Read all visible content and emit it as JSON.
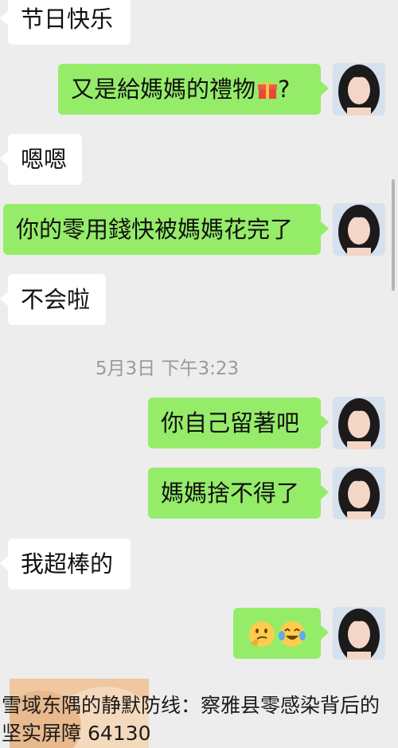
{
  "messages": [
    {
      "side": "in",
      "text": "节日快乐"
    },
    {
      "side": "out",
      "text": "又是給媽媽的禮物",
      "emoji": "gift",
      "suffix": "?"
    },
    {
      "side": "in",
      "text": "嗯嗯"
    },
    {
      "side": "out",
      "text": "你的零用錢快被媽媽花完了"
    },
    {
      "side": "in",
      "text": "不会啦"
    },
    {
      "side": "out",
      "text": "你自己留著吧"
    },
    {
      "side": "out",
      "text": "媽媽捨不得了"
    },
    {
      "side": "in",
      "text": "我超棒的"
    },
    {
      "side": "out",
      "emojis": [
        "thinking-face",
        "crying-laughing-face"
      ]
    }
  ],
  "timestamp": "5月3日 下午3:23",
  "overlay_caption": "雪域东隅的静默防线：察雅县零感染背后的坚实屏障  64130",
  "colors": {
    "background": "#ededed",
    "incoming_bubble": "#ffffff",
    "outgoing_bubble": "#95ec69",
    "timestamp_text": "#9a9a9a"
  },
  "icons": {
    "gift": "gift-icon",
    "emoji_1": "thinking-face-emoji",
    "emoji_2": "crying-laughing-face-emoji",
    "avatar": "user-avatar"
  }
}
